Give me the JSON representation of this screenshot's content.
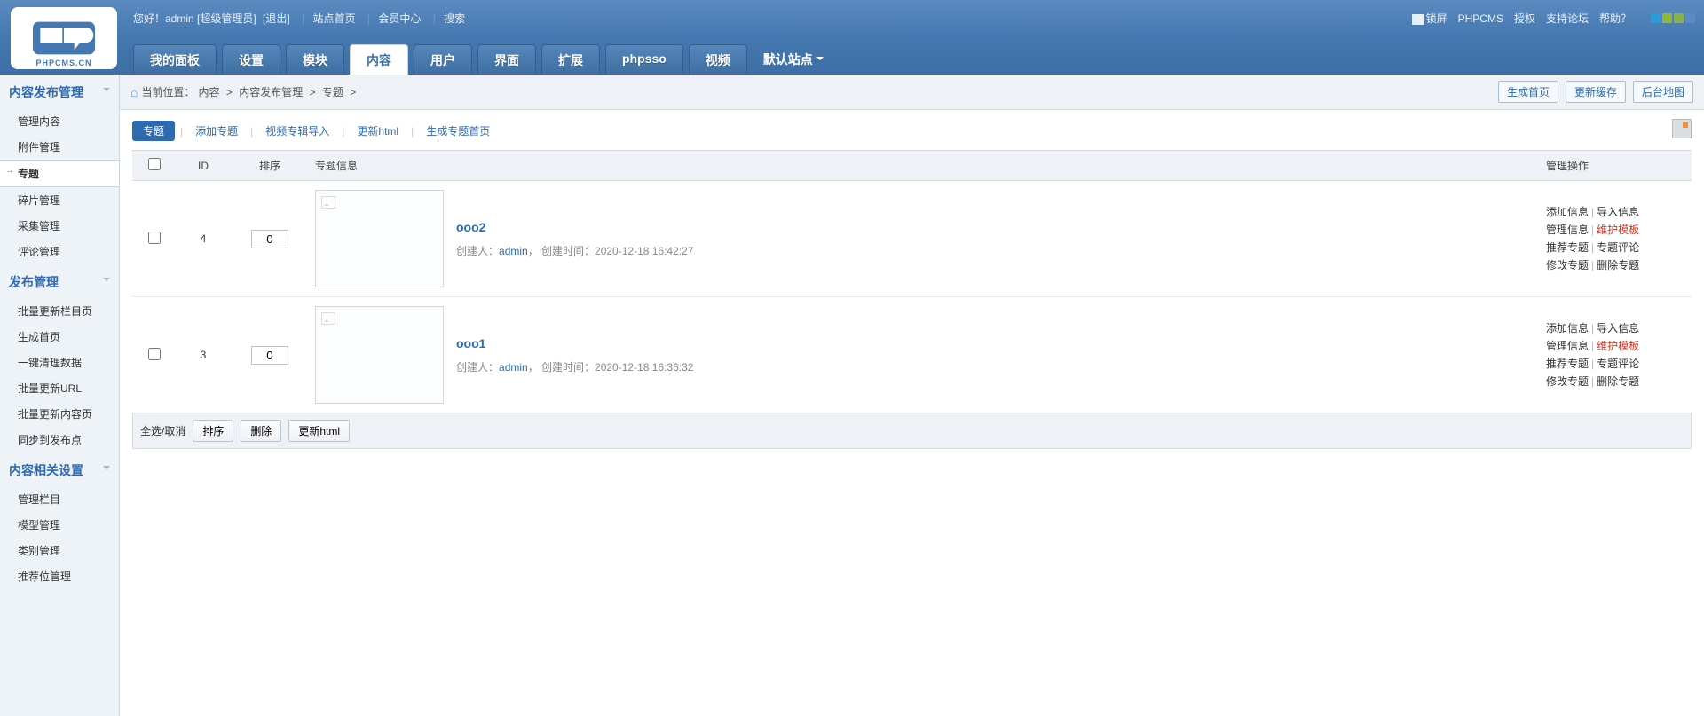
{
  "header": {
    "greeting": "您好！admin [超级管理员]",
    "logout": "[退出]",
    "links": [
      "站点首页",
      "会员中心",
      "搜索"
    ],
    "right_links": [
      "锁屏",
      "PHPCMS",
      "授权",
      "支持论坛",
      "帮助？"
    ],
    "logo_text": "PHPCMS.CN"
  },
  "nav": {
    "tabs": [
      "我的面板",
      "设置",
      "模块",
      "内容",
      "用户",
      "界面",
      "扩展",
      "phpsso",
      "视频"
    ],
    "active": 3,
    "site_select": "默认站点"
  },
  "sidebar": [
    {
      "group": "内容发布管理",
      "items": [
        "管理内容",
        "附件管理",
        "专题",
        "碎片管理",
        "采集管理",
        "评论管理"
      ],
      "active": 2
    },
    {
      "group": "发布管理",
      "items": [
        "批量更新栏目页",
        "生成首页",
        "一键清理数据",
        "批量更新URL",
        "批量更新内容页",
        "同步到发布点"
      ]
    },
    {
      "group": "内容相关设置",
      "items": [
        "管理栏目",
        "模型管理",
        "类别管理",
        "推荐位管理"
      ]
    }
  ],
  "crumb": {
    "label": "当前位置：",
    "path": [
      "内容",
      "内容发布管理",
      "专题"
    ],
    "buttons": [
      "生成首页",
      "更新缓存",
      "后台地图"
    ]
  },
  "tabs": {
    "active": "专题",
    "links": [
      "添加专题",
      "视频专辑导入",
      "更新html",
      "生成专题首页"
    ]
  },
  "table": {
    "headers": {
      "id": "ID",
      "sort": "排序",
      "info": "专题信息",
      "ops": "管理操作"
    },
    "rows": [
      {
        "id": "4",
        "sort": "0",
        "title": "ooo2",
        "creator_label": "创建人：",
        "creator": "admin",
        "created_label": "，  创建时间：",
        "created": "2020-12-18 16:42:27"
      },
      {
        "id": "3",
        "sort": "0",
        "title": "ooo1",
        "creator_label": "创建人：",
        "creator": "admin",
        "created_label": "，  创建时间：",
        "created": "2020-12-18 16:36:32"
      }
    ],
    "op_labels": {
      "add": "添加信息",
      "import": "导入信息",
      "manage": "管理信息",
      "maintain": "维护模板",
      "recommend": "推荐专题",
      "comment": "专题评论",
      "edit": "修改专题",
      "delete": "删除专题"
    }
  },
  "footer": {
    "select_all": "全选/取消",
    "buttons": [
      "排序",
      "删除",
      "更新html"
    ]
  }
}
